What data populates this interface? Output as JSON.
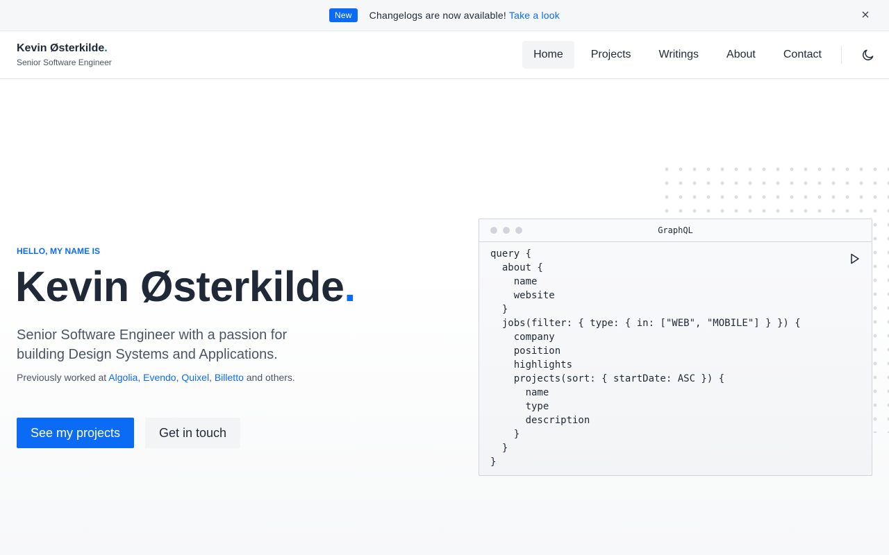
{
  "announcement": {
    "badge": "New",
    "message": "Changelogs are now available!",
    "link": "Take a look",
    "close": "×"
  },
  "header": {
    "name": "Kevin Østerkilde",
    "name_dot": ".",
    "role": "Senior Software Engineer",
    "nav": [
      {
        "label": "Home",
        "active": true
      },
      {
        "label": "Projects"
      },
      {
        "label": "Writings"
      },
      {
        "label": "About"
      },
      {
        "label": "Contact"
      }
    ],
    "theme_icon": "moon-icon"
  },
  "hero": {
    "eyebrow": "HELLO, MY NAME IS",
    "title": "Kevin Østerkilde",
    "title_dot": ".",
    "tagline": "Senior Software Engineer with a passion for building Design Systems and Applications.",
    "worked_prefix": "Previously worked at",
    "companies": [
      "Algolia",
      "Evendo",
      "Quixel",
      "Billetto"
    ],
    "worked_suffix": "and others.",
    "primary_button": "See my projects",
    "secondary_button": "Get in touch"
  },
  "graphql": {
    "title": "GraphQL",
    "play_icon": "play-icon",
    "code": "query {\n  about {\n    name\n    website\n  }\n  jobs(filter: { type: { in: [\"WEB\", \"MOBILE\"] } }) {\n    company\n    position\n    highlights\n    projects(sort: { startDate: ASC }) {\n      name\n      type\n      description\n    }\n  }\n}"
  },
  "colors": {
    "accent": "#0b6bf5",
    "text": "#1f2937",
    "muted": "#4b5563"
  }
}
